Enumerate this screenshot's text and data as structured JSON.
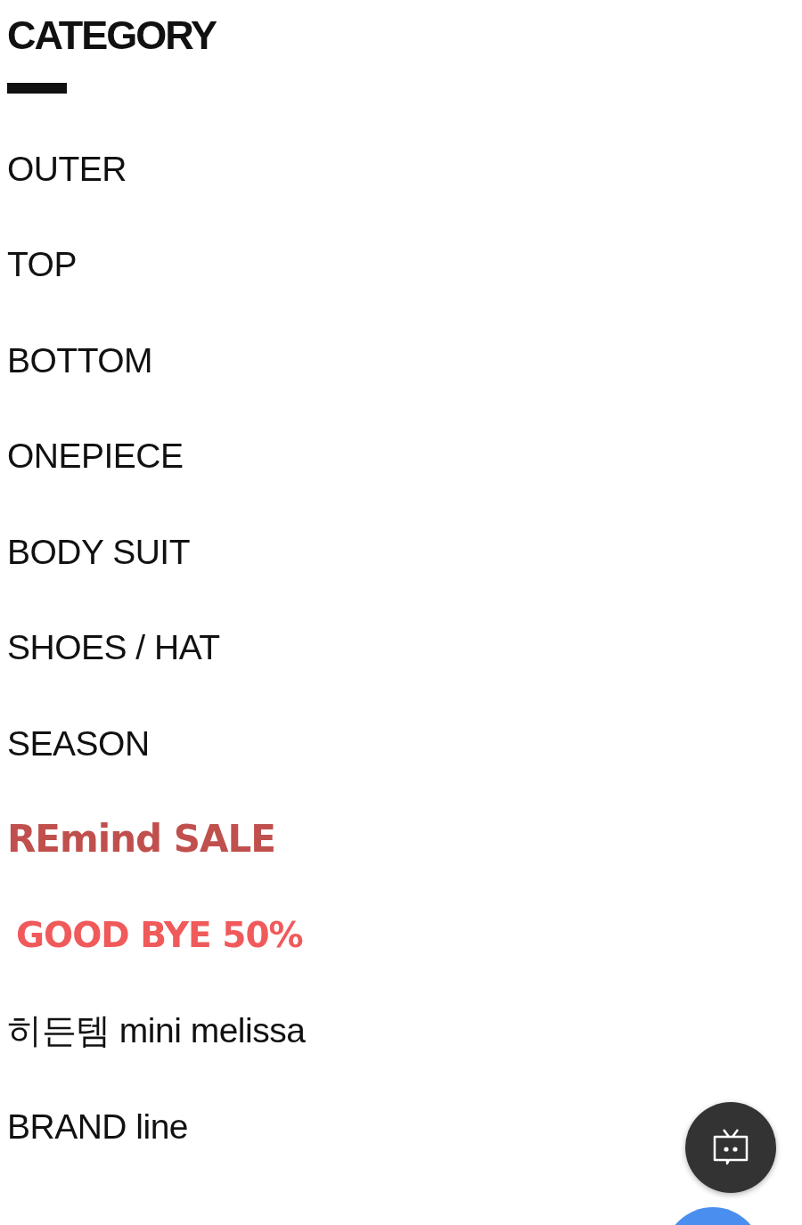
{
  "title": "CATEGORY",
  "items": [
    {
      "kind": "text",
      "label": "OUTER"
    },
    {
      "kind": "text",
      "label": "TOP"
    },
    {
      "kind": "text",
      "label": "BOTTOM"
    },
    {
      "kind": "text",
      "label": "ONEPIECE"
    },
    {
      "kind": "text",
      "label": "BODY SUIT"
    },
    {
      "kind": "text",
      "label": "SHOES / HAT"
    },
    {
      "kind": "text",
      "label": "SEASON"
    },
    {
      "kind": "banner",
      "label": "REmind SALE",
      "color": "#c0504d"
    },
    {
      "kind": "banner",
      "label": "GOOD BYE 50%",
      "color": "#f05a5a"
    },
    {
      "kind": "text",
      "label": "히든템 mini melissa"
    },
    {
      "kind": "text",
      "label": "BRAND line"
    }
  ]
}
